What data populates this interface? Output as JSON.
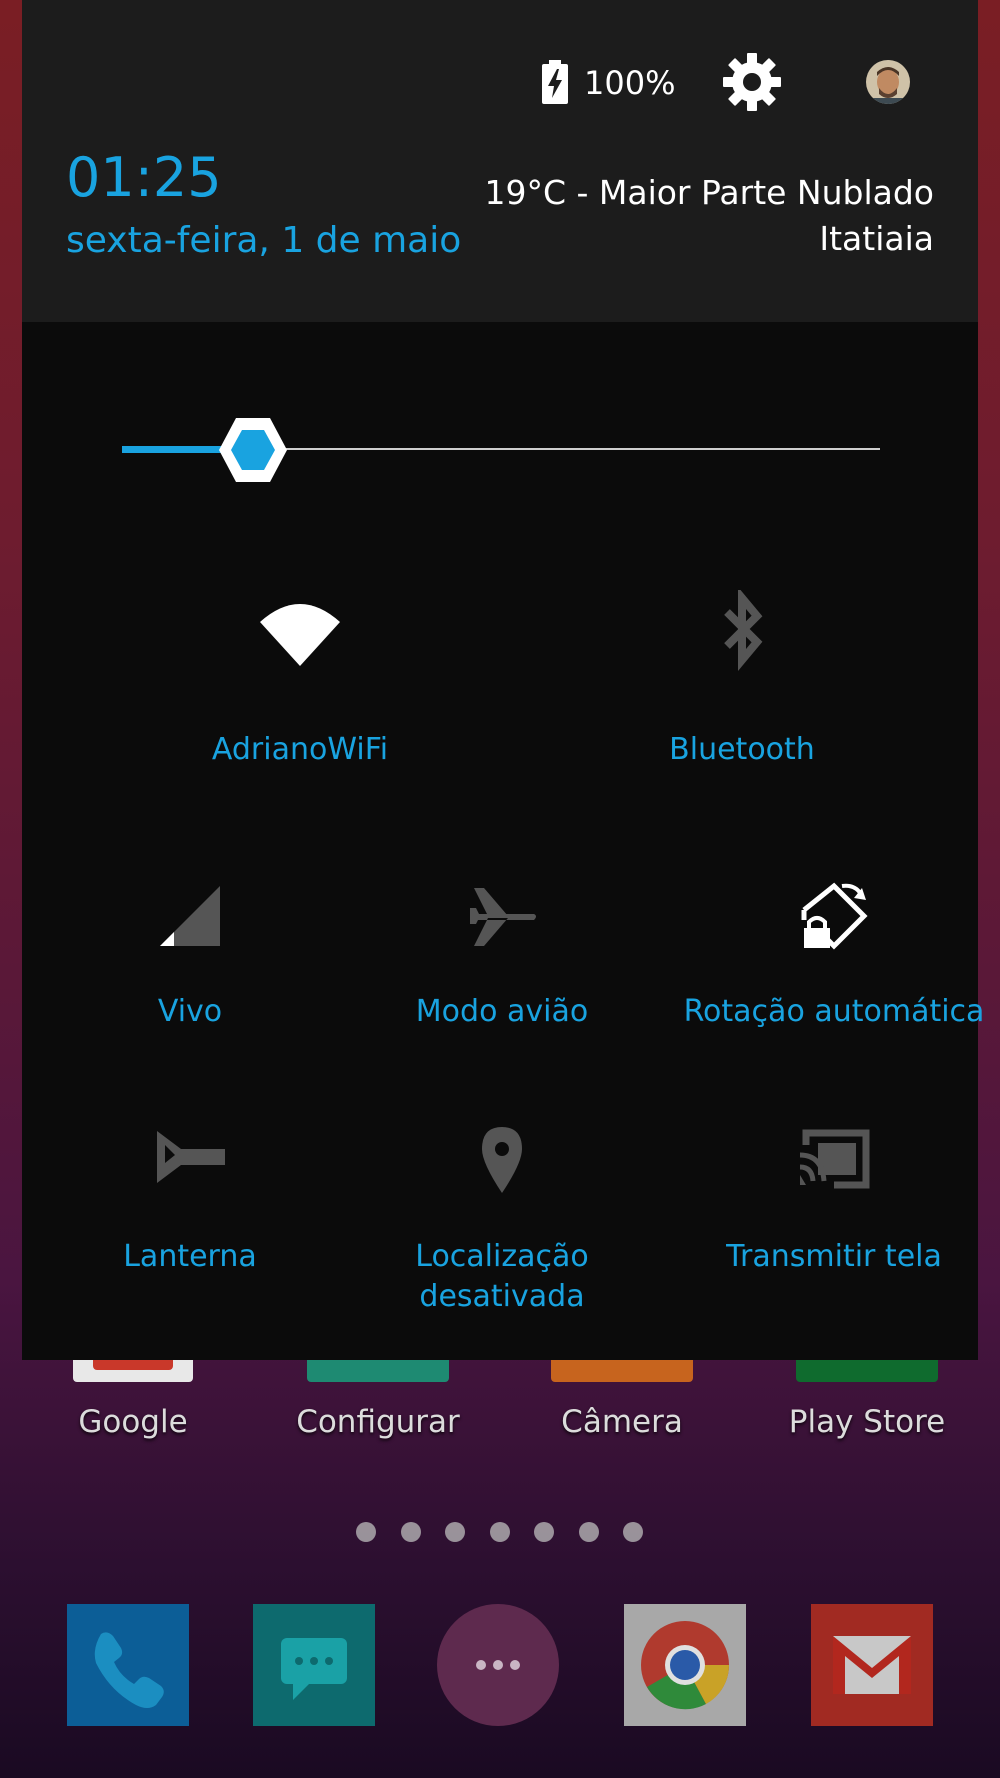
{
  "status": {
    "battery_label": "100%"
  },
  "header": {
    "time": "01:25",
    "date": "sexta-feira, 1 de maio",
    "weather_line": "19°C - Maior Parte Nublado",
    "location": "Itatiaia"
  },
  "brightness": {
    "level_fraction": 0.16
  },
  "tiles": [
    {
      "label": "AdrianoWiFi",
      "icon": "wifi-icon",
      "active": true
    },
    {
      "label": "Bluetooth",
      "icon": "bluetooth-icon",
      "active": false
    },
    {
      "label": "Vivo",
      "icon": "cell-signal-icon",
      "active": false
    },
    {
      "label": "Modo avião",
      "icon": "airplane-icon",
      "active": false
    },
    {
      "label": "Rotação automática",
      "icon": "rotation-lock-icon",
      "active": true
    },
    {
      "label": "Lanterna",
      "icon": "flashlight-icon",
      "active": false
    },
    {
      "label": "Localização\ndesativada",
      "icon": "location-icon",
      "active": false
    },
    {
      "label": "Transmitir tela",
      "icon": "cast-icon",
      "active": false
    }
  ],
  "home_apps": [
    {
      "label": "Google"
    },
    {
      "label": "Configurar"
    },
    {
      "label": "Câmera"
    },
    {
      "label": "Play Store"
    }
  ],
  "dock": [
    {
      "name": "phone-icon"
    },
    {
      "name": "messages-icon"
    },
    {
      "name": "app-drawer-icon"
    },
    {
      "name": "chrome-icon"
    },
    {
      "name": "gmail-icon"
    }
  ],
  "pager": {
    "pages": 7
  },
  "colors": {
    "accent": "#19a3e0",
    "shade_bg": "#0b0b0b",
    "header_bg": "#1c1c1c",
    "inactive_icon": "#555555",
    "active_icon": "#ffffff"
  }
}
